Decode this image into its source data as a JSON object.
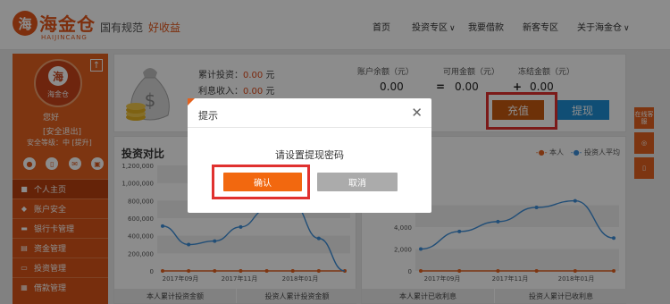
{
  "header": {
    "logo_glyph": "海",
    "logo_name": "海金仓",
    "logo_en": "HAIJINCANG",
    "slogan_primary": "国有规范",
    "slogan_secondary": "好收益",
    "nav": [
      {
        "label": "首页",
        "caret": false
      },
      {
        "label": "投资专区",
        "caret": true
      },
      {
        "label": "我要借款",
        "caret": false
      },
      {
        "label": "新客专区",
        "caret": false
      },
      {
        "label": "关于海金仓",
        "caret": true
      }
    ]
  },
  "sidebar": {
    "avatar_glyph": "海",
    "avatar_text": "海金仓",
    "greeting": "您好",
    "logout": "[安全退出]",
    "security_level": "安全等级：中 [提升]",
    "icons": [
      "user-icon",
      "phone-icon",
      "mail-icon",
      "lock-icon"
    ],
    "menu": [
      {
        "label": "个人主页",
        "icon": "home-icon",
        "active": true
      },
      {
        "label": "账户安全",
        "icon": "shield-icon",
        "active": false
      },
      {
        "label": "银行卡管理",
        "icon": "card-icon",
        "active": false
      },
      {
        "label": "资金管理",
        "icon": "wallet-icon",
        "active": false
      },
      {
        "label": "投资管理",
        "icon": "monitor-icon",
        "active": false
      },
      {
        "label": "借款管理",
        "icon": "doc-icon",
        "active": false
      }
    ]
  },
  "summary": {
    "total_invest_label": "累计投资：",
    "total_invest_value": "0.00",
    "total_invest_unit": "元",
    "interest_label": "利息收入：",
    "interest_value": "0.00",
    "interest_unit": "元",
    "balance_header": "账户余额（元）",
    "available_header": "可用金额（元）",
    "frozen_header": "冻结金额（元）",
    "balance_value": "0.00",
    "available_value": "0.00",
    "frozen_value": "0.00",
    "op_equals": "=",
    "op_plus": "+",
    "recharge_label": "充值",
    "withdraw_label": "提现"
  },
  "chart_left": {
    "title": "投资对比",
    "footer_left": "本人累计投资金额",
    "footer_right": "投资人累计投资金额"
  },
  "chart_right": {
    "legend_self": "本人",
    "legend_avg": "投资人平均",
    "footer_left": "本人累计已收利息",
    "footer_right": "投资人累计已收利息"
  },
  "chart_data": [
    {
      "type": "line",
      "title": "投资对比",
      "x": [
        "2017年09月",
        "2017年11月",
        "2018年01月"
      ],
      "ylim": [
        0,
        1200000
      ],
      "yticks": [
        "1,200,000",
        "1,000,000",
        "800,000",
        "600,000",
        "400,000",
        "200,000",
        "0"
      ],
      "series": [
        {
          "name": "本人",
          "color": "#e4621f",
          "values": [
            0,
            0,
            0,
            0,
            0,
            0,
            0,
            0
          ]
        },
        {
          "name": "投资人平均",
          "color": "#3c8ed9",
          "values": [
            510000,
            300000,
            340000,
            500000,
            700000,
            760000,
            370000,
            0
          ]
        }
      ]
    },
    {
      "type": "line",
      "title": "",
      "x": [
        "2017年09月",
        "2017年11月",
        "2018年01月"
      ],
      "ylim": [
        0,
        8000
      ],
      "yticks": [
        "6,000",
        "4,000",
        "2,000",
        "0"
      ],
      "legend": [
        "本人",
        "投资人平均"
      ],
      "series": [
        {
          "name": "本人",
          "color": "#e4621f",
          "values": [
            0,
            0,
            0,
            0,
            0,
            0
          ]
        },
        {
          "name": "投资人平均",
          "color": "#3c8ed9",
          "values": [
            2000,
            3600,
            4500,
            5800,
            6400,
            3000
          ]
        }
      ]
    }
  ],
  "float_bar": {
    "service_label": "在线客服",
    "wechat_icon": "wechat-icon",
    "mobile_icon": "mobile-icon"
  },
  "dialog": {
    "title": "提示",
    "message": "请设置提现密码",
    "confirm_label": "确认",
    "cancel_label": "取消",
    "close_glyph": "✕"
  },
  "colors": {
    "brand": "#e4621f",
    "accent_blue": "#1e8fd6",
    "highlight": "#e0312f"
  }
}
